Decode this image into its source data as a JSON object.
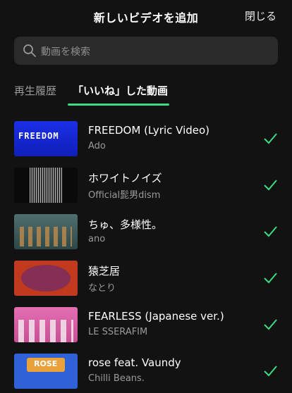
{
  "header": {
    "title": "新しいビデオを追加",
    "close_label": "閉じる"
  },
  "search": {
    "placeholder": "動画を検索"
  },
  "tabs": [
    {
      "label": "再生履歴",
      "active": false
    },
    {
      "label": "「いいね」した動画",
      "active": true
    }
  ],
  "thumbnail_texts": {
    "freedom": "FREEDOM",
    "rose": "ROSE"
  },
  "videos": [
    {
      "title": "FREEDOM (Lyric Video)",
      "artist": "Ado",
      "selected": true
    },
    {
      "title": "ホワイトノイズ",
      "artist": "Official髭男dism",
      "selected": true
    },
    {
      "title": "ちゅ、多様性。",
      "artist": "ano",
      "selected": true
    },
    {
      "title": "猿芝居",
      "artist": "なとり",
      "selected": true
    },
    {
      "title": "FEARLESS (Japanese ver.)",
      "artist": "LE SSERAFIM",
      "selected": true
    },
    {
      "title": "rose feat. Vaundy",
      "artist": "Chilli Beans.",
      "selected": true
    }
  ],
  "colors": {
    "accent": "#3ddc84",
    "background": "#121212",
    "search_bg": "#2a2a2a"
  }
}
